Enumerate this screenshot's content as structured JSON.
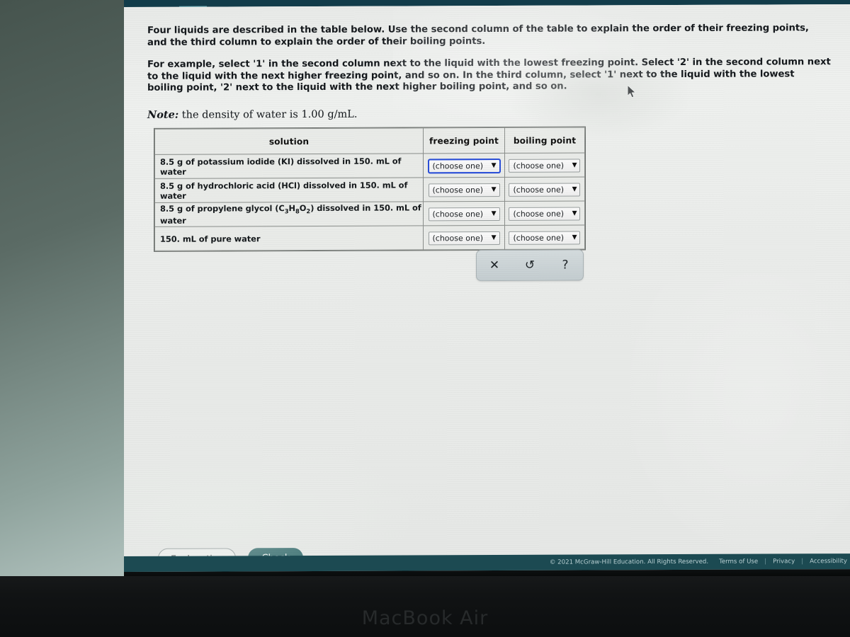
{
  "window": {
    "collapse_tab_icon": "chevron-down-icon"
  },
  "prose": {
    "paragraph_1": "Four liquids are described in the table below. Use the second column of the table to explain the order of their freezing points, and the third column to explain the order of their boiling points.",
    "paragraph_2": "For example, select '1' in the second column next to the liquid with the lowest freezing point. Select '2' in the second column next to the liquid with the next higher freezing point, and so on. In the third column, select '1' next to the liquid with the lowest boiling point, '2' next to the liquid with the next higher boiling point, and so on.",
    "note_label": "Note:",
    "note_text": " the density of water is 1.00 g/mL."
  },
  "table": {
    "headers": {
      "solution": "solution",
      "freezing_point": "freezing point",
      "boiling_point": "boiling point"
    },
    "rows": [
      {
        "solution_prefix": "8.5 g of potassium iodide (KI) dissolved in 150. mL of water",
        "freezing_value": "(choose one)",
        "boiling_value": "(choose one)",
        "freezing_focused": true
      },
      {
        "solution_prefix": "8.5 g of hydrochloric acid (HCl) dissolved in 150. mL of water",
        "freezing_value": "(choose one)",
        "boiling_value": "(choose one)",
        "freezing_focused": false
      },
      {
        "solution_prefix": "8.5 g of propylene glycol (C3H8O2) dissolved in 150. mL of water",
        "freezing_value": "(choose one)",
        "boiling_value": "(choose one)",
        "freezing_focused": false
      },
      {
        "solution_prefix": "150. mL of pure water",
        "freezing_value": "(choose one)",
        "boiling_value": "(choose one)",
        "freezing_focused": false
      }
    ],
    "select_caret": "▼"
  },
  "toolbar": {
    "clear_icon": "✕",
    "undo_icon": "↺",
    "help_icon": "?",
    "clear_name": "clear-button",
    "undo_name": "reset-button",
    "help_name": "help-button"
  },
  "actions": {
    "explanation_label": "Explanation",
    "check_label": "Check"
  },
  "footer": {
    "copyright": "© 2021 McGraw-Hill Education. All Rights Reserved.",
    "terms": "Terms of Use",
    "privacy": "Privacy",
    "accessibility": "Accessibility",
    "separator": "|"
  },
  "device": {
    "label": "MacBook Air"
  },
  "colors": {
    "top_bar": "#123c4a",
    "tab_teal": "#5fa0ab",
    "check_button": "#2d6668",
    "footer_bar": "#1c4a52",
    "focus_ring": "#2b4fd8"
  }
}
